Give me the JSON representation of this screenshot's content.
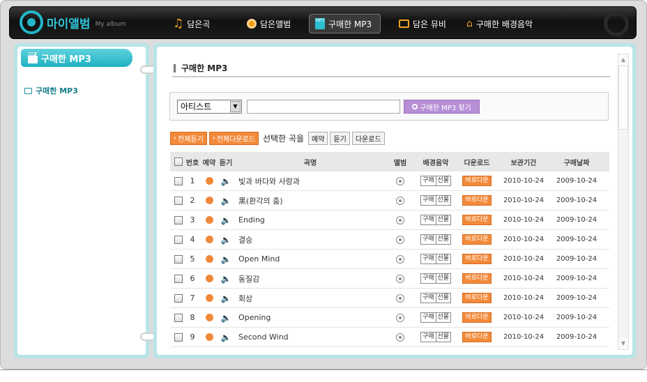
{
  "nav": {
    "logo_text": "마이앨범",
    "logo_sub": "My album",
    "items": [
      {
        "label": "담은곡",
        "icon": "music-note-icon"
      },
      {
        "label": "담은앨범",
        "icon": "disc-icon"
      },
      {
        "label": "구매한 MP3",
        "icon": "mp3-icon",
        "active": true
      },
      {
        "label": "담은 뮤비",
        "icon": "tv-icon"
      },
      {
        "label": "구매한 배경음악",
        "icon": "home-icon"
      }
    ],
    "mp3_glyph": "MP3"
  },
  "sidebar": {
    "title": "구매한 MP3",
    "link": "구매한 MP3"
  },
  "main": {
    "title": "구매한 MP3",
    "search": {
      "select_value": "아티스트",
      "button_label": "구매한 MP3 찾기"
    },
    "actions": {
      "play_all": "전체듣기",
      "download_all": "전체다운로드",
      "selected_label": "선택한 곡을",
      "reserve": "예약",
      "listen": "듣기",
      "download": "다운로드"
    },
    "table": {
      "headers": {
        "num": "번호",
        "reserve": "예약",
        "listen": "듣기",
        "song": "곡명",
        "album": "앨범",
        "bgm": "배경음악",
        "download": "다운로드",
        "keep": "보관기간",
        "buy": "구매날짜"
      },
      "bgm_buy": "구매",
      "bgm_gift": "선물",
      "download_label": "바로다운",
      "rows": [
        {
          "num": "1",
          "song": "빛과 바다와 사랑과",
          "keep": "2010-10-24",
          "buy": "2009-10-24"
        },
        {
          "num": "2",
          "song": "黑(환각의 춤)",
          "keep": "2010-10-24",
          "buy": "2009-10-24"
        },
        {
          "num": "3",
          "song": "Ending",
          "keep": "2010-10-24",
          "buy": "2009-10-24"
        },
        {
          "num": "4",
          "song": "결승",
          "keep": "2010-10-24",
          "buy": "2009-10-24"
        },
        {
          "num": "5",
          "song": "Open Mind",
          "keep": "2010-10-24",
          "buy": "2009-10-24"
        },
        {
          "num": "6",
          "song": "동질감",
          "keep": "2010-10-24",
          "buy": "2009-10-24"
        },
        {
          "num": "7",
          "song": "회상",
          "keep": "2010-10-24",
          "buy": "2009-10-24"
        },
        {
          "num": "8",
          "song": "Opening",
          "keep": "2010-10-24",
          "buy": "2009-10-24"
        },
        {
          "num": "9",
          "song": "Second Wind",
          "keep": "2010-10-24",
          "buy": "2009-10-24"
        }
      ]
    }
  }
}
